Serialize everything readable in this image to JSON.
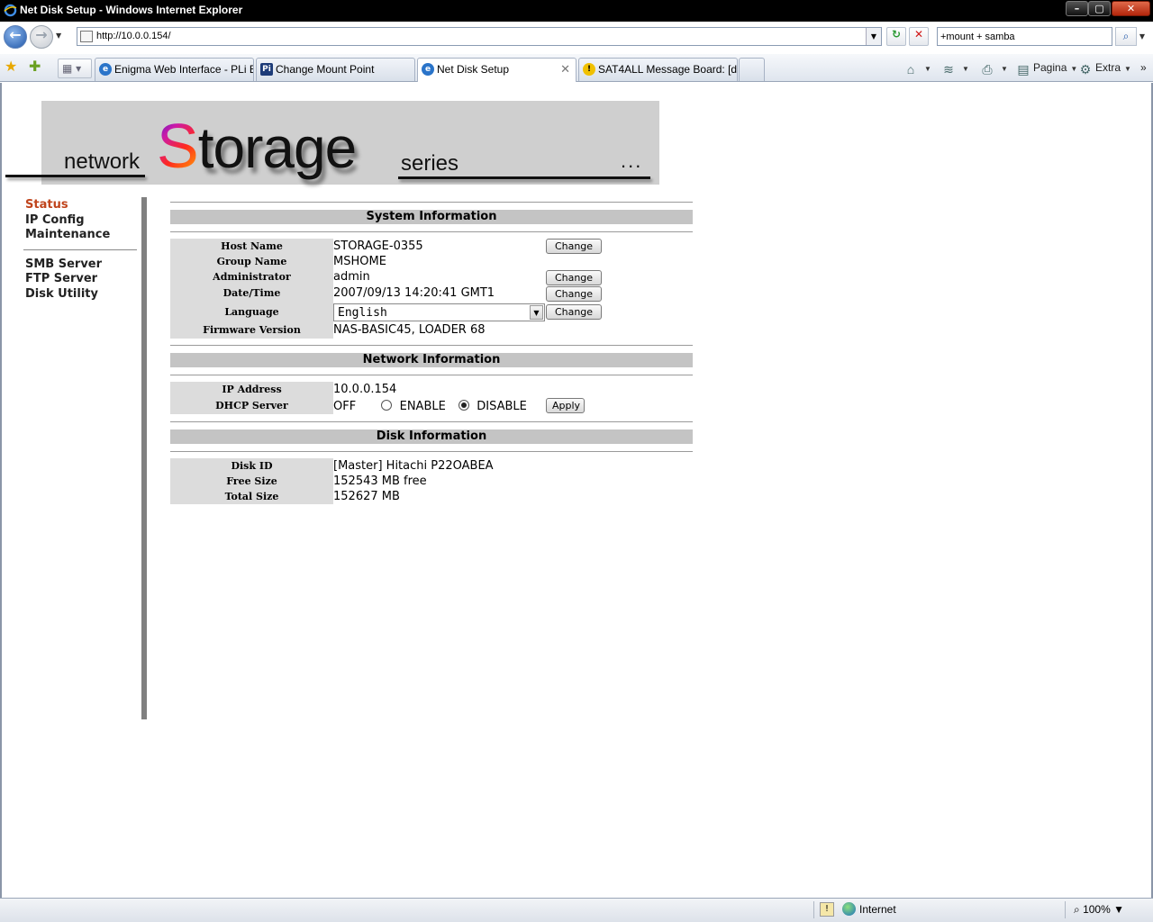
{
  "window": {
    "title": "Net Disk Setup - Windows Internet Explorer",
    "min_label": "–",
    "max_label": "▢",
    "close_label": "✕"
  },
  "addressbar": {
    "back_glyph": "←",
    "forward_glyph": "→",
    "url": "http://10.0.0.154/",
    "search_value": "+mount + samba",
    "refresh_glyph": "↻",
    "stop_glyph": "✕",
    "search_glyph": "⌕"
  },
  "tabs": [
    {
      "label": "Enigma Web Interface - PLi E...",
      "icon": "ie-icon"
    },
    {
      "label": "Change Mount Point",
      "icon": "pli-icon"
    },
    {
      "label": "Net Disk Setup",
      "icon": "ie-icon",
      "active": true
    },
    {
      "label": "SAT4ALL Message Board: [d...",
      "icon": "lightbulb-icon"
    }
  ],
  "commandbar": {
    "page_label": "Pagina",
    "tools_label": "Extra",
    "more_glyph": "»"
  },
  "banner": {
    "word1": "network",
    "word2_first": "S",
    "word2_rest": "torage",
    "word3": "series",
    "dots": "..."
  },
  "nav": {
    "items": [
      {
        "label": "Status",
        "active": true
      },
      {
        "label": "IP Config"
      },
      {
        "label": "Maintenance"
      }
    ],
    "items2": [
      {
        "label": "SMB Server"
      },
      {
        "label": "FTP Server"
      },
      {
        "label": "Disk Utility"
      }
    ]
  },
  "system": {
    "heading": "System Information",
    "host_label": "Host Name",
    "host_value": "STORAGE-0355",
    "group_label": "Group Name",
    "group_value": "MSHOME",
    "admin_label": "Administrator",
    "admin_value": "admin",
    "datetime_label": "Date/Time",
    "datetime_value": "2007/09/13 14:20:41 GMT1",
    "language_label": "Language",
    "language_value": "English",
    "firmware_label": "Firmware Version",
    "firmware_value": "NAS-BASIC45, LOADER 68",
    "change_label": "Change"
  },
  "network": {
    "heading": "Network Information",
    "ip_label": "IP Address",
    "ip_value": "10.0.0.154",
    "dhcp_label": "DHCP Server",
    "dhcp_state": "OFF",
    "enable_label": "ENABLE",
    "disable_label": "DISABLE",
    "apply_label": "Apply"
  },
  "disk": {
    "heading": "Disk Information",
    "id_label": "Disk ID",
    "id_value": "[Master] Hitachi P22OABEA",
    "free_label": "Free Size",
    "free_value": "152543 MB free",
    "total_label": "Total Size",
    "total_value": "152627 MB"
  },
  "statusbar": {
    "zone": "Internet",
    "zoom": "100%"
  }
}
